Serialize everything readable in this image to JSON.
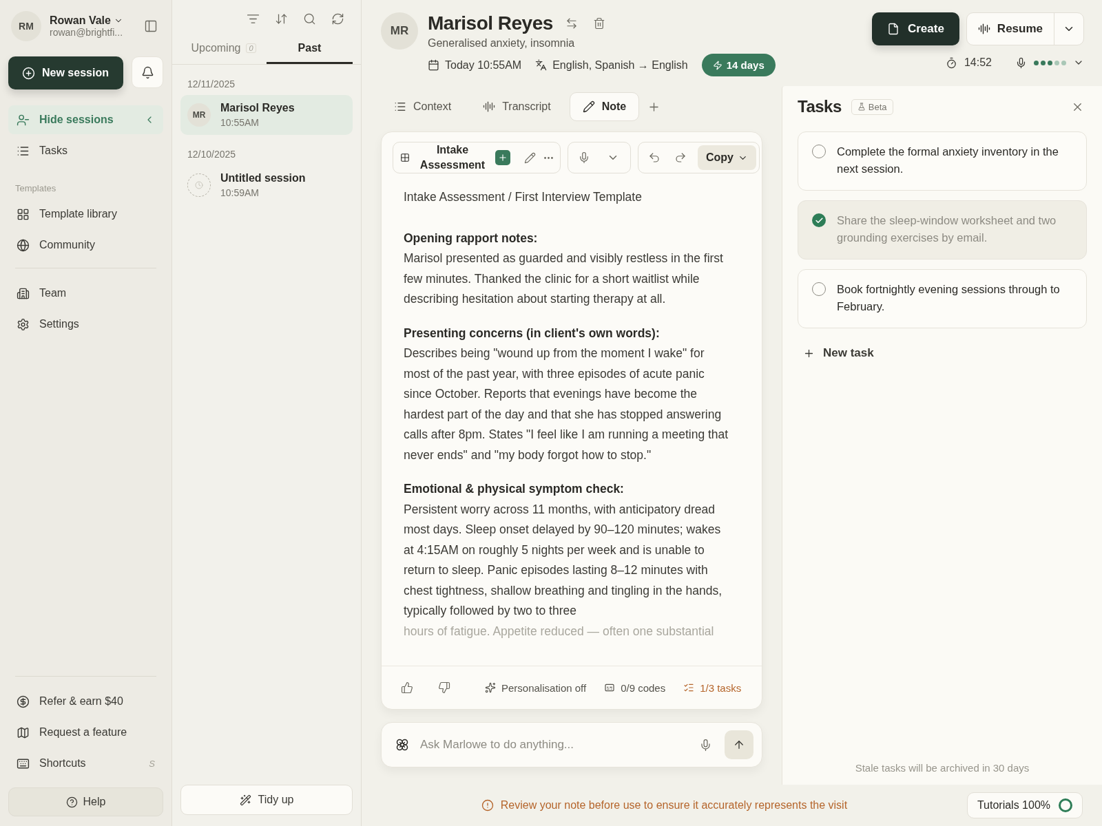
{
  "sidebar": {
    "user": {
      "initials": "RM",
      "name": "Rowan Vale",
      "email": "rowan@brightfi..."
    },
    "new_session": "New session",
    "nav": [
      {
        "label": "Hide sessions",
        "selected": true
      },
      {
        "label": "Tasks",
        "selected": false
      }
    ],
    "templates_heading": "Templates",
    "template_items": [
      {
        "label": "Template library"
      },
      {
        "label": "Community"
      }
    ],
    "admin_items": [
      {
        "label": "Team"
      },
      {
        "label": "Settings"
      }
    ],
    "footer_items": [
      {
        "label": "Refer & earn $40"
      },
      {
        "label": "Request a feature"
      },
      {
        "label": "Shortcuts",
        "shortcut": "S"
      }
    ],
    "help": "Help"
  },
  "sessions": {
    "tabs": [
      {
        "label": "Upcoming",
        "count": "0",
        "selected": false
      },
      {
        "label": "Past",
        "selected": true
      }
    ],
    "groups": [
      {
        "date": "12/11/2025",
        "items": [
          {
            "kind": "avatar",
            "initials": "MR",
            "title": "Marisol Reyes",
            "time": "10:55AM",
            "selected": true
          }
        ]
      },
      {
        "date": "12/10/2025",
        "items": [
          {
            "kind": "pending",
            "title": "Untitled session",
            "time": "10:59AM",
            "selected": false
          }
        ]
      }
    ],
    "tidy_up": "Tidy up"
  },
  "header": {
    "initials": "MR",
    "name": "Marisol Reyes",
    "subtitle": "Generalised anxiety, insomnia",
    "date": "Today 10:55AM",
    "languages": "English, Spanish → English",
    "badge": "14 days",
    "create": "Create",
    "resume": "Resume",
    "timer": "14:52",
    "mic": {
      "level": 0.6
    }
  },
  "note_tabs": [
    {
      "label": "Context",
      "selected": false
    },
    {
      "label": "Transcript",
      "selected": false
    },
    {
      "label": "Note",
      "selected": true
    }
  ],
  "note": {
    "template": "Intake Assessment",
    "copy": "Copy",
    "title": "Intake Assessment / First Interview Template",
    "sections": [
      {
        "heading": "Opening rapport notes:",
        "body": "Marisol presented as guarded and visibly restless in the first few minutes. Thanked the clinic for a short waitlist while describing hesitation about starting therapy at all."
      },
      {
        "heading": "Presenting concerns (in client's own words):",
        "body": "Describes being \"wound up from the moment I wake\" for most of the past year, with three episodes of acute panic since October. Reports that evenings have become the hardest part of the day and that she has stopped answering calls after 8pm. States \"I feel like I am running a meeting that never ends\" and \"my body forgot how to stop.\""
      },
      {
        "heading": "Emotional & physical symptom check:",
        "body": "Persistent worry across 11 months, with anticipatory dread most days. Sleep onset delayed by 90–120 minutes; wakes at 4:15AM on roughly 5 nights per week and is unable to return to sleep. Panic episodes lasting 8–12 minutes with chest tightness, shallow breathing and tingling in the hands, typically followed by two to three"
      }
    ],
    "faded_line": "hours of fatigue. Appetite reduced — often one substantial",
    "personalisation": "Personalisation off",
    "codes": "0/9 codes",
    "tasks": "1/3 tasks"
  },
  "chat": {
    "placeholder": "Ask Marlowe to do anything..."
  },
  "warning": "Review your note before use to ensure it accurately represents the visit",
  "tasks_panel": {
    "title": "Tasks",
    "badge": "Beta",
    "items": [
      {
        "text": "Complete the formal anxiety inventory in the next session.",
        "checked": false
      },
      {
        "text": "Share the sleep-window worksheet and two grounding exercises by email.",
        "checked": true
      },
      {
        "text": "Book fortnightly evening sessions through to February.",
        "checked": false
      }
    ],
    "new_task": "New task",
    "footnote": "Stale tasks will be archived in 30 days"
  },
  "tutorials": {
    "label": "Tutorials 100%"
  }
}
